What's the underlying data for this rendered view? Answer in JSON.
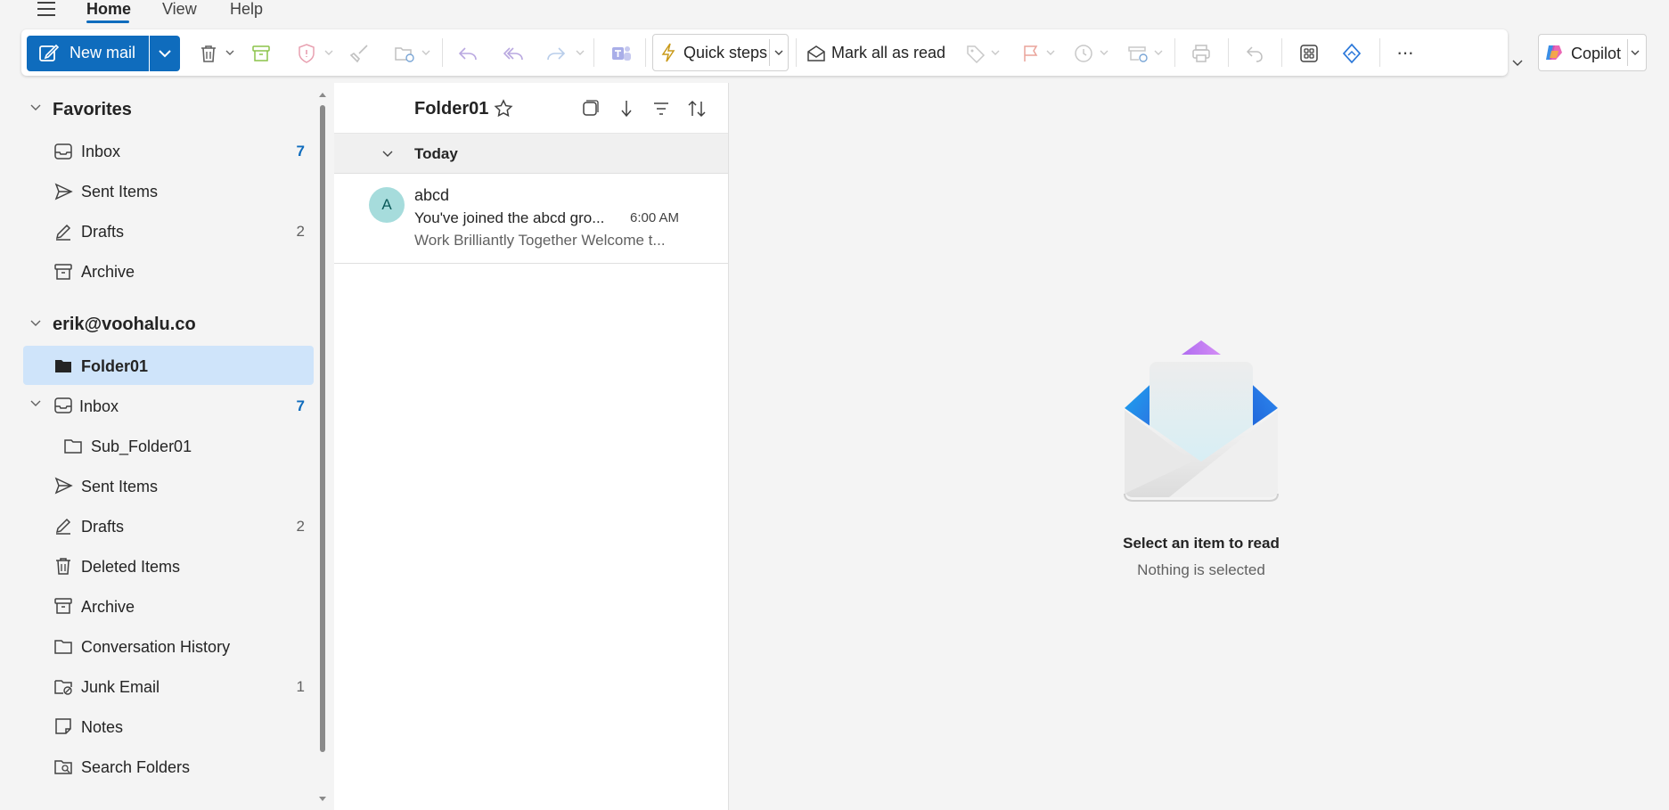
{
  "tabs": [
    {
      "label": "Home",
      "active": true
    },
    {
      "label": "View",
      "active": false
    },
    {
      "label": "Help",
      "active": false
    }
  ],
  "ribbon": {
    "new_mail": "New mail",
    "quick_steps": "Quick steps",
    "mark_all_read": "Mark all as read",
    "copilot": "Copilot",
    "more": "···"
  },
  "nav": {
    "favorites_header": "Favorites",
    "favorites": [
      {
        "label": "Inbox",
        "count": "7",
        "icon": "inbox-icon"
      },
      {
        "label": "Sent Items",
        "count": "",
        "icon": "send-icon"
      },
      {
        "label": "Drafts",
        "count": "2",
        "icon": "pencil-icon"
      },
      {
        "label": "Archive",
        "count": "",
        "icon": "archive-icon"
      }
    ],
    "account_header": "erik@voohalu.co",
    "account_items": [
      {
        "label": "Folder01",
        "count": "",
        "icon": "folder-filled-icon",
        "selected": true
      },
      {
        "label": "Inbox",
        "count": "7",
        "icon": "inbox-icon"
      },
      {
        "label": "Sub_Folder01",
        "count": "",
        "icon": "folder-icon"
      },
      {
        "label": "Sent Items",
        "count": "",
        "icon": "send-icon"
      },
      {
        "label": "Drafts",
        "count": "2",
        "icon": "pencil-icon"
      },
      {
        "label": "Deleted Items",
        "count": "",
        "icon": "trash-icon"
      },
      {
        "label": "Archive",
        "count": "",
        "icon": "archive-icon"
      },
      {
        "label": "Conversation History",
        "count": "",
        "icon": "folder-icon"
      },
      {
        "label": "Junk Email",
        "count": "1",
        "icon": "junk-icon"
      },
      {
        "label": "Notes",
        "count": "",
        "icon": "note-icon"
      },
      {
        "label": "Search Folders",
        "count": "",
        "icon": "search-folder-icon"
      }
    ]
  },
  "message_list": {
    "folder_title": "Folder01",
    "group_label": "Today",
    "messages": [
      {
        "avatar_letter": "A",
        "sender": "abcd",
        "subject": "You've joined the abcd gro...",
        "time": "6:00 AM",
        "preview": "Work Brilliantly Together Welcome t..."
      }
    ]
  },
  "reading_pane": {
    "title": "Select an item to read",
    "subtitle": "Nothing is selected"
  },
  "colors": {
    "accent": "#0f6cbd",
    "selected_nav": "#cfe4fa",
    "avatar_bg": "#a6dcdc"
  }
}
